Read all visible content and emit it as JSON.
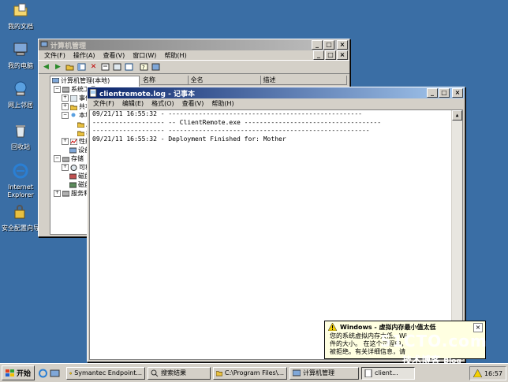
{
  "desktop": {
    "icons": [
      {
        "name": "我的文档"
      },
      {
        "name": "我的电脑"
      },
      {
        "name": "网上邻居"
      },
      {
        "name": "回收站"
      },
      {
        "name": "Internet\nExplorer"
      },
      {
        "name": "安全配置向导"
      }
    ]
  },
  "compmgmt": {
    "title": "计算机管理",
    "menu": [
      "文件(F)",
      "操作(A)",
      "查看(V)",
      "窗口(W)",
      "帮助(H)"
    ],
    "tree": [
      {
        "label": "计算机管理(本地)"
      },
      {
        "label": "系统工具"
      },
      {
        "label": "事件查"
      },
      {
        "label": "共享文"
      },
      {
        "label": "本地用"
      },
      {
        "label": "用"
      },
      {
        "label": "组"
      },
      {
        "label": "性能日"
      },
      {
        "label": "设备管"
      },
      {
        "label": "存储"
      },
      {
        "label": "可移动"
      },
      {
        "label": "磁盘碎"
      },
      {
        "label": "磁盘管"
      },
      {
        "label": "服务和应"
      }
    ],
    "columns": [
      "名称",
      "全名",
      "描述"
    ]
  },
  "notepad": {
    "title": "clientremote.log - 记事本",
    "menu": [
      "文件(F)",
      "编辑(E)",
      "格式(O)",
      "查看(V)",
      "帮助(H)"
    ],
    "lines": [
      "09/21/11 16:55:32 - ---------------------------------------------------",
      "------------------- -- ClientRemote.exe ------------------------------------",
      "------------------- -----------------------------------------------------",
      "09/21/11 16:55:32 - Deployment Finished for: Mother"
    ]
  },
  "taskbar": {
    "start": "开始",
    "tasks": [
      {
        "label": "Symantec Endpoint..."
      },
      {
        "label": "搜索结果"
      },
      {
        "label": "C:\\Program Files\\..."
      },
      {
        "label": "计算机管理"
      },
      {
        "label": "client..."
      }
    ],
    "clock": "16:57"
  },
  "balloon": {
    "title": "Windows - 虚拟内存最小值太低",
    "body1": "您的系统虚拟内存太低。Wi",
    "body2": "件的大小。 在这个过程中，",
    "body3": "被拒绝。有关详细信息，请"
  },
  "watermark": {
    "line1": "51CTO.com",
    "line2": "技术博客",
    "line3": "Blog"
  },
  "colors": {
    "desktop": "#3a6ea5",
    "active_title": "#0a246a",
    "balloon": "#ffffe1"
  }
}
